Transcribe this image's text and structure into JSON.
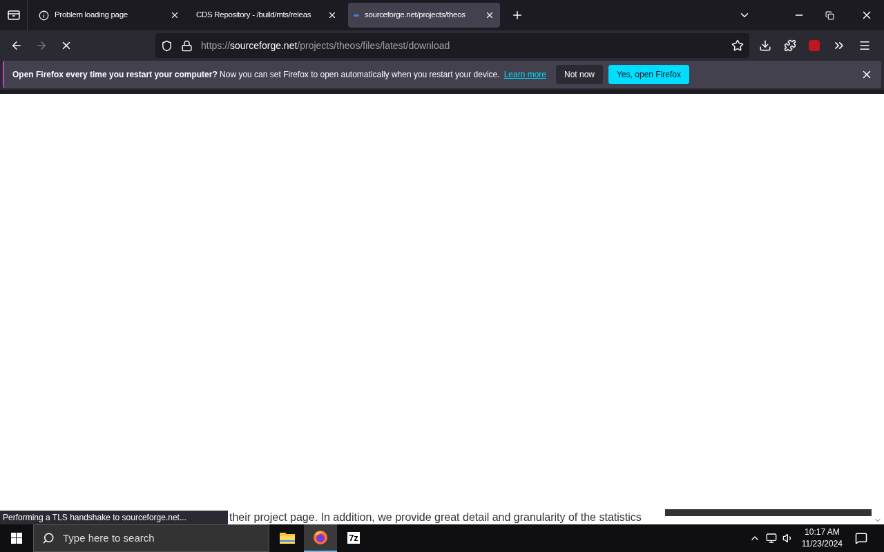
{
  "tabs": [
    {
      "label": "Problem loading page",
      "selected": false,
      "kind": "info"
    },
    {
      "label": "CDS Repository - /build/mts/releas",
      "selected": false,
      "kind": "plain"
    },
    {
      "label": "sourceforge.net/projects/theos",
      "selected": true,
      "kind": "loading"
    }
  ],
  "address": {
    "host": "sourceforge.net",
    "path": "/projects/theos/files/latest/download",
    "scheme": "https://"
  },
  "notification": {
    "title": "Open Firefox every time you restart your computer?",
    "message": "Now you can set Firefox to open automatically when you restart your device.",
    "link": "Learn more",
    "buttons": [
      "Not now",
      "Yes, open Firefox"
    ]
  },
  "page": {
    "text": "their project page. In addition, we provide great detail and granularity of the statistics"
  },
  "status": "Performing a TLS handshake to sourceforge.net...",
  "taskbar": {
    "search_placeholder": "Type here to search",
    "apps": [
      {
        "kind": "folder",
        "selected": false
      },
      {
        "kind": "firefox",
        "selected": true
      },
      {
        "kind": "archiver",
        "label": "7z",
        "selected": false
      }
    ],
    "time": "10:17 AM",
    "date": "11/23/2024"
  }
}
